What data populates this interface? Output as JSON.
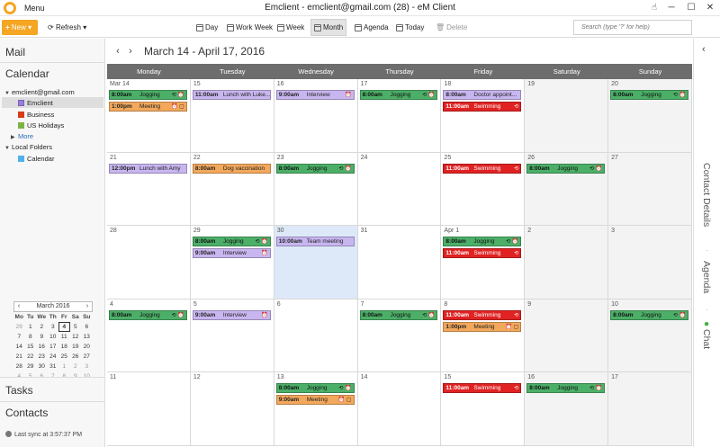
{
  "titlebar": {
    "menu": "Menu",
    "title": "Emclient - emclient@gmail.com (28) - eM Client"
  },
  "toolbar": {
    "new": "New",
    "refresh": "Refresh",
    "views": [
      "Day",
      "Work Week",
      "Week",
      "Month",
      "Agenda",
      "Today",
      "Delete"
    ],
    "active_view": "Month",
    "search_placeholder": "Search (type '?' for help)"
  },
  "sidebar": {
    "mail": "Mail",
    "calendar": "Calendar",
    "account": "emclient@gmail.com",
    "calendars": [
      {
        "label": "Emclient",
        "color": "#9a7fd6"
      },
      {
        "label": "Business",
        "color": "#d93a1a"
      },
      {
        "label": "US Holidays",
        "color": "#7cb342"
      }
    ],
    "more": "More",
    "local_folders": "Local Folders",
    "local_calendar": {
      "label": "Calendar",
      "color": "#4fb3e8"
    },
    "tasks": "Tasks",
    "contacts": "Contacts",
    "last_sync": "Last sync at 3:57:37 PM"
  },
  "mini_calendar": {
    "title": "March 2016",
    "weekdays": [
      "Mo",
      "Tu",
      "We",
      "Th",
      "Fr",
      "Sa",
      "Su"
    ],
    "today": "4",
    "weeks": [
      [
        {
          "d": "29",
          "m": true
        },
        {
          "d": "1"
        },
        {
          "d": "2"
        },
        {
          "d": "3"
        },
        {
          "d": "4",
          "t": true
        },
        {
          "d": "5"
        },
        {
          "d": "6"
        }
      ],
      [
        {
          "d": "7"
        },
        {
          "d": "8"
        },
        {
          "d": "9"
        },
        {
          "d": "10"
        },
        {
          "d": "11"
        },
        {
          "d": "12"
        },
        {
          "d": "13"
        }
      ],
      [
        {
          "d": "14"
        },
        {
          "d": "15"
        },
        {
          "d": "16"
        },
        {
          "d": "17"
        },
        {
          "d": "18"
        },
        {
          "d": "19"
        },
        {
          "d": "20"
        }
      ],
      [
        {
          "d": "21"
        },
        {
          "d": "22"
        },
        {
          "d": "23"
        },
        {
          "d": "24"
        },
        {
          "d": "25"
        },
        {
          "d": "26"
        },
        {
          "d": "27"
        }
      ],
      [
        {
          "d": "28"
        },
        {
          "d": "29"
        },
        {
          "d": "30"
        },
        {
          "d": "31"
        },
        {
          "d": "1",
          "m": true
        },
        {
          "d": "2",
          "m": true
        },
        {
          "d": "3",
          "m": true
        }
      ],
      [
        {
          "d": "4",
          "m": true
        },
        {
          "d": "5",
          "m": true
        },
        {
          "d": "6",
          "m": true
        },
        {
          "d": "7",
          "m": true
        },
        {
          "d": "8",
          "m": true
        },
        {
          "d": "9",
          "m": true
        },
        {
          "d": "10",
          "m": true
        }
      ]
    ]
  },
  "calendar": {
    "date_range": "March 14 - April 17, 2016",
    "day_names": [
      "Monday",
      "Tuesday",
      "Wednesday",
      "Thursday",
      "Friday",
      "Saturday",
      "Sunday"
    ],
    "weeks": [
      {
        "days": [
          {
            "num": "Mar 14",
            "events": [
              {
                "time": "8:00am",
                "title": "Jogging",
                "color": "green",
                "icons": "⟲ ⏰"
              },
              {
                "time": "1:00pm",
                "title": "Meeting",
                "color": "orange",
                "icons": "⏰ ▢"
              }
            ]
          },
          {
            "num": "15",
            "events": [
              {
                "time": "11:00am",
                "title": "Lunch with Luke...",
                "color": "purple",
                "icons": ""
              }
            ]
          },
          {
            "num": "16",
            "events": [
              {
                "time": "9:00am",
                "title": "Interview",
                "color": "purple",
                "icons": "⏰"
              }
            ]
          },
          {
            "num": "17",
            "events": [
              {
                "time": "8:00am",
                "title": "Jogging",
                "color": "green",
                "icons": "⟲ ⏰"
              }
            ]
          },
          {
            "num": "18",
            "events": [
              {
                "time": "8:00am",
                "title": "Doctor appoint...",
                "color": "purple",
                "icons": ""
              },
              {
                "time": "11:00am",
                "title": "Swimming",
                "color": "red",
                "icons": "⟲"
              }
            ]
          },
          {
            "num": "19",
            "events": []
          },
          {
            "num": "20",
            "events": [
              {
                "time": "8:00am",
                "title": "Jogging",
                "color": "green",
                "icons": "⟲ ⏰"
              }
            ]
          }
        ]
      },
      {
        "days": [
          {
            "num": "21",
            "events": [
              {
                "time": "12:00pm",
                "title": "Lunch with Amy",
                "color": "purple",
                "icons": ""
              }
            ]
          },
          {
            "num": "22",
            "events": [
              {
                "time": "8:00am",
                "title": "Dog vaccination",
                "color": "orange",
                "icons": ""
              }
            ]
          },
          {
            "num": "23",
            "events": [
              {
                "time": "8:00am",
                "title": "Jogging",
                "color": "green",
                "icons": "⟲ ⏰"
              }
            ]
          },
          {
            "num": "24",
            "events": []
          },
          {
            "num": "25",
            "events": [
              {
                "time": "11:00am",
                "title": "Swimming",
                "color": "red",
                "icons": "⟲"
              }
            ]
          },
          {
            "num": "26",
            "events": [
              {
                "time": "8:00am",
                "title": "Jogging",
                "color": "green",
                "icons": "⟲ ⏰"
              }
            ]
          },
          {
            "num": "27",
            "events": []
          }
        ]
      },
      {
        "days": [
          {
            "num": "28",
            "events": []
          },
          {
            "num": "29",
            "events": [
              {
                "time": "8:00am",
                "title": "Jogging",
                "color": "green",
                "icons": "⟲ ⏰"
              },
              {
                "time": "9:00am",
                "title": "Interview",
                "color": "purple",
                "icons": "⏰"
              }
            ]
          },
          {
            "num": "30",
            "selected": true,
            "events": [
              {
                "time": "10:00am",
                "title": "Team meeting",
                "color": "purple",
                "icons": ""
              }
            ]
          },
          {
            "num": "31",
            "events": []
          },
          {
            "num": "Apr 1",
            "events": [
              {
                "time": "8:00am",
                "title": "Jogging",
                "color": "green",
                "icons": "⟲ ⏰"
              },
              {
                "time": "11:00am",
                "title": "Swimming",
                "color": "red",
                "icons": "⟲"
              }
            ]
          },
          {
            "num": "2",
            "events": []
          },
          {
            "num": "3",
            "events": []
          }
        ]
      },
      {
        "days": [
          {
            "num": "4",
            "events": [
              {
                "time": "8:00am",
                "title": "Jogging",
                "color": "green",
                "icons": "⟲ ⏰"
              }
            ]
          },
          {
            "num": "5",
            "events": [
              {
                "time": "9:00am",
                "title": "Interview",
                "color": "purple",
                "icons": "⏰"
              }
            ]
          },
          {
            "num": "6",
            "events": []
          },
          {
            "num": "7",
            "events": [
              {
                "time": "8:00am",
                "title": "Jogging",
                "color": "green",
                "icons": "⟲ ⏰"
              }
            ]
          },
          {
            "num": "8",
            "events": [
              {
                "time": "11:00am",
                "title": "Swimming",
                "color": "red",
                "icons": "⟲"
              },
              {
                "time": "1:00pm",
                "title": "Meeting",
                "color": "orange",
                "icons": "⏰ ▢"
              }
            ]
          },
          {
            "num": "9",
            "events": []
          },
          {
            "num": "10",
            "events": [
              {
                "time": "8:00am",
                "title": "Jogging",
                "color": "green",
                "icons": "⟲ ⏰"
              }
            ]
          }
        ]
      },
      {
        "days": [
          {
            "num": "11",
            "events": []
          },
          {
            "num": "12",
            "events": []
          },
          {
            "num": "13",
            "events": [
              {
                "time": "8:00am",
                "title": "Jogging",
                "color": "green",
                "icons": "⟲ ⏰"
              },
              {
                "time": "9:00am",
                "title": "Meeting",
                "color": "orange",
                "icons": "⏰ ▢"
              }
            ]
          },
          {
            "num": "14",
            "events": []
          },
          {
            "num": "15",
            "events": [
              {
                "time": "11:00am",
                "title": "Swimming",
                "color": "red",
                "icons": "⟲"
              }
            ]
          },
          {
            "num": "16",
            "events": [
              {
                "time": "8:00am",
                "title": "Jogging",
                "color": "green",
                "icons": "⟲ ⏰"
              }
            ]
          },
          {
            "num": "17",
            "events": []
          }
        ]
      }
    ]
  },
  "right_pane": {
    "tabs": [
      "Contact Details",
      "Agenda",
      "Chat"
    ]
  }
}
